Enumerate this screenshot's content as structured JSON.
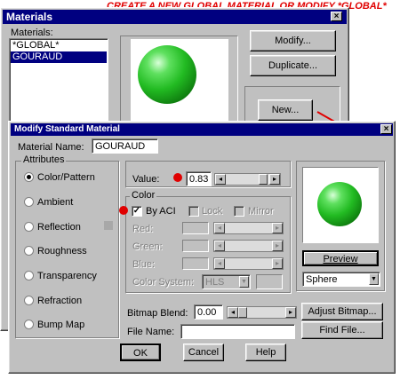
{
  "annotation": "CREATE A NEW GLOBAL MATERIAL OR MODIFY *GLOBAL*",
  "colors": {
    "title_bar": "#000080",
    "face": "#c0c0c0",
    "annotation": "#e00000",
    "sphere": "#22bb22"
  },
  "materials_window": {
    "title": "Materials",
    "list_label": "Materials:",
    "items": [
      "*GLOBAL*",
      "GOURAUD"
    ],
    "selected_index": 1,
    "modify_button": "Modify...",
    "duplicate_button": "Duplicate...",
    "new_button": "New..."
  },
  "dialog": {
    "title": "Modify Standard Material",
    "material_name_label": "Material Name:",
    "material_name_value": "GOURAUD",
    "attributes": {
      "label": "Attributes",
      "options": [
        "Color/Pattern",
        "Ambient",
        "Reflection",
        "Roughness",
        "Transparency",
        "Refraction",
        "Bump Map"
      ],
      "selected": 0
    },
    "value_label": "Value:",
    "value": "0.83",
    "value_level": 0.83,
    "color_group": {
      "label": "Color",
      "by_aci_label": "By ACI",
      "by_aci_checked": true,
      "lock_label": "Lock",
      "mirror_label": "Mirror",
      "red_label": "Red:",
      "green_label": "Green:",
      "blue_label": "Blue:",
      "color_system_label": "Color System:",
      "color_system_value": "HLS"
    },
    "preview_button": "Preview",
    "preview_shape": "Sphere",
    "bitmap_blend_label": "Bitmap Blend:",
    "bitmap_blend_value": "0.00",
    "adjust_bitmap_button": "Adjust Bitmap...",
    "file_name_label": "File Name:",
    "file_name_value": "",
    "find_file_button": "Find File...",
    "ok_button": "OK",
    "cancel_button": "Cancel",
    "help_button": "Help"
  }
}
